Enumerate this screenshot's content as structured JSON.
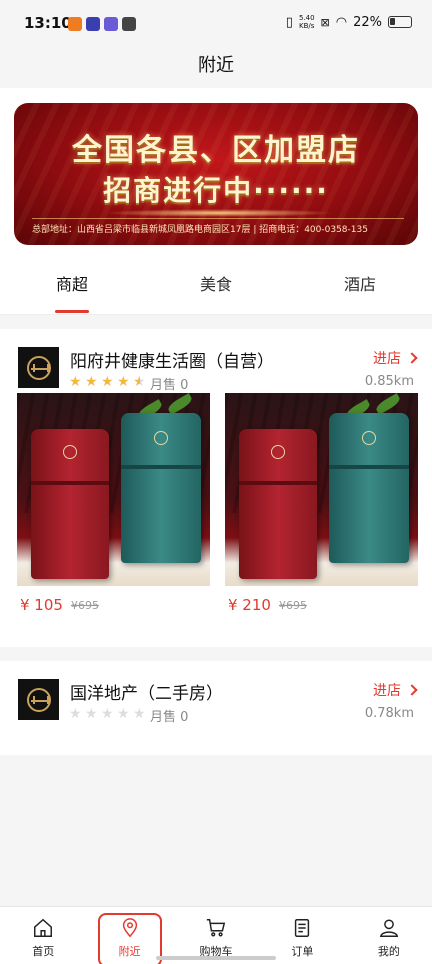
{
  "status_bar": {
    "time": "13:10",
    "net_speed": "5.40",
    "net_unit": "KB/s",
    "battery": "22%"
  },
  "header": {
    "title": "附近"
  },
  "banner": {
    "line1": "全国各县、区加盟店",
    "line2": "招商进行中······",
    "footer": "总部地址：山西省吕梁市临县新城凤凰路电商园区17层 | 招商电话：400-0358-135"
  },
  "tabs": [
    {
      "label": "商超",
      "active": true
    },
    {
      "label": "美食",
      "active": false
    },
    {
      "label": "酒店",
      "active": false
    }
  ],
  "stores": [
    {
      "name": "阳府井健康生活圈（自营）",
      "rating": 4.5,
      "sold": "月售 0",
      "distance": "0.85km",
      "enter_label": "进店",
      "products": [
        {
          "price": "¥ 105",
          "original_price": "¥695"
        },
        {
          "price": "¥ 210",
          "original_price": "¥695"
        }
      ]
    },
    {
      "name": "国洋地产（二手房）",
      "rating": 0,
      "sold": "月售 0",
      "distance": "0.78km",
      "enter_label": "进店",
      "products": []
    }
  ],
  "bottom_nav": [
    {
      "label": "首页",
      "icon": "home-icon",
      "active": false
    },
    {
      "label": "附近",
      "icon": "location-pin-icon",
      "active": true
    },
    {
      "label": "购物车",
      "icon": "cart-icon",
      "active": false
    },
    {
      "label": "订单",
      "icon": "order-list-icon",
      "active": false
    },
    {
      "label": "我的",
      "icon": "user-icon",
      "active": false
    }
  ],
  "colors": {
    "accent": "#e23a2e",
    "star": "#f5b83a"
  }
}
